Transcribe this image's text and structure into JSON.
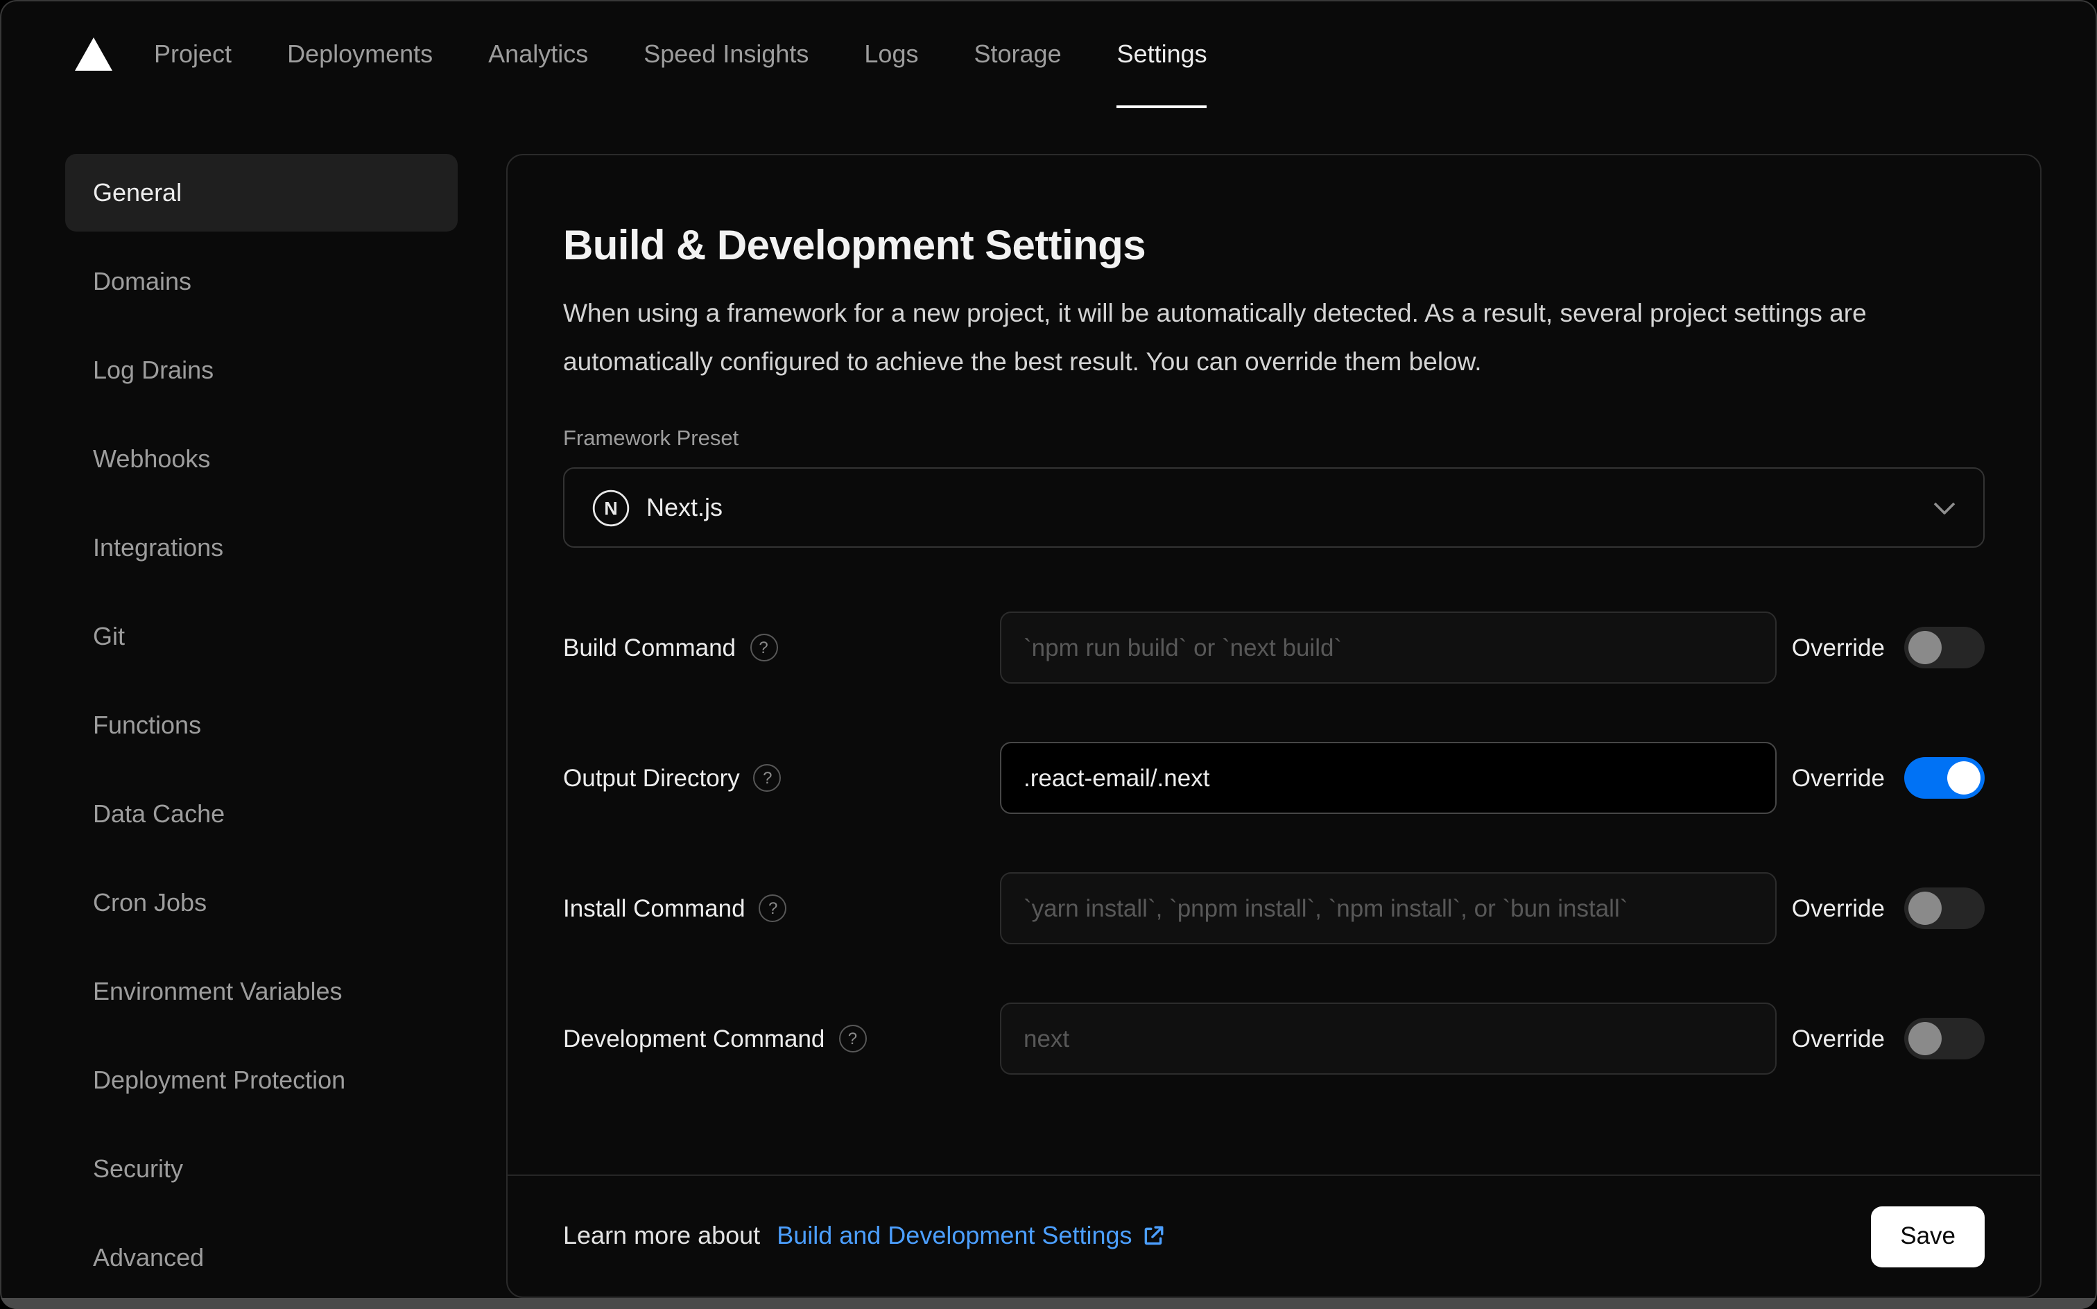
{
  "nav": {
    "items": [
      {
        "label": "Project",
        "active": false
      },
      {
        "label": "Deployments",
        "active": false
      },
      {
        "label": "Analytics",
        "active": false
      },
      {
        "label": "Speed Insights",
        "active": false
      },
      {
        "label": "Logs",
        "active": false
      },
      {
        "label": "Storage",
        "active": false
      },
      {
        "label": "Settings",
        "active": true
      }
    ]
  },
  "sidebar": {
    "items": [
      {
        "label": "General",
        "active": true
      },
      {
        "label": "Domains",
        "active": false
      },
      {
        "label": "Log Drains",
        "active": false
      },
      {
        "label": "Webhooks",
        "active": false
      },
      {
        "label": "Integrations",
        "active": false
      },
      {
        "label": "Git",
        "active": false
      },
      {
        "label": "Functions",
        "active": false
      },
      {
        "label": "Data Cache",
        "active": false
      },
      {
        "label": "Cron Jobs",
        "active": false
      },
      {
        "label": "Environment Variables",
        "active": false
      },
      {
        "label": "Deployment Protection",
        "active": false
      },
      {
        "label": "Security",
        "active": false
      },
      {
        "label": "Advanced",
        "active": false
      }
    ]
  },
  "main": {
    "title": "Build & Development Settings",
    "description": "When using a framework for a new project, it will be automatically detected. As a result, several project settings are automatically configured to achieve the best result. You can override them below.",
    "framework": {
      "label": "Framework Preset",
      "value": "Next.js"
    },
    "rows": [
      {
        "label": "Build Command",
        "placeholder": "`npm run build` or `next build`",
        "value": "",
        "override_label": "Override",
        "override_on": false
      },
      {
        "label": "Output Directory",
        "placeholder": "",
        "value": ".react-email/.next",
        "override_label": "Override",
        "override_on": true
      },
      {
        "label": "Install Command",
        "placeholder": "`yarn install`, `pnpm install`, `npm install`, or `bun install`",
        "value": "",
        "override_label": "Override",
        "override_on": false
      },
      {
        "label": "Development Command",
        "placeholder": "next",
        "value": "",
        "override_label": "Override",
        "override_on": false
      }
    ],
    "footer": {
      "learn_more_prefix": "Learn more about ",
      "learn_more_link": "Build and Development Settings",
      "save_label": "Save"
    }
  },
  "colors": {
    "accent_blue": "#0072f5",
    "link_blue": "#4c9fff"
  }
}
